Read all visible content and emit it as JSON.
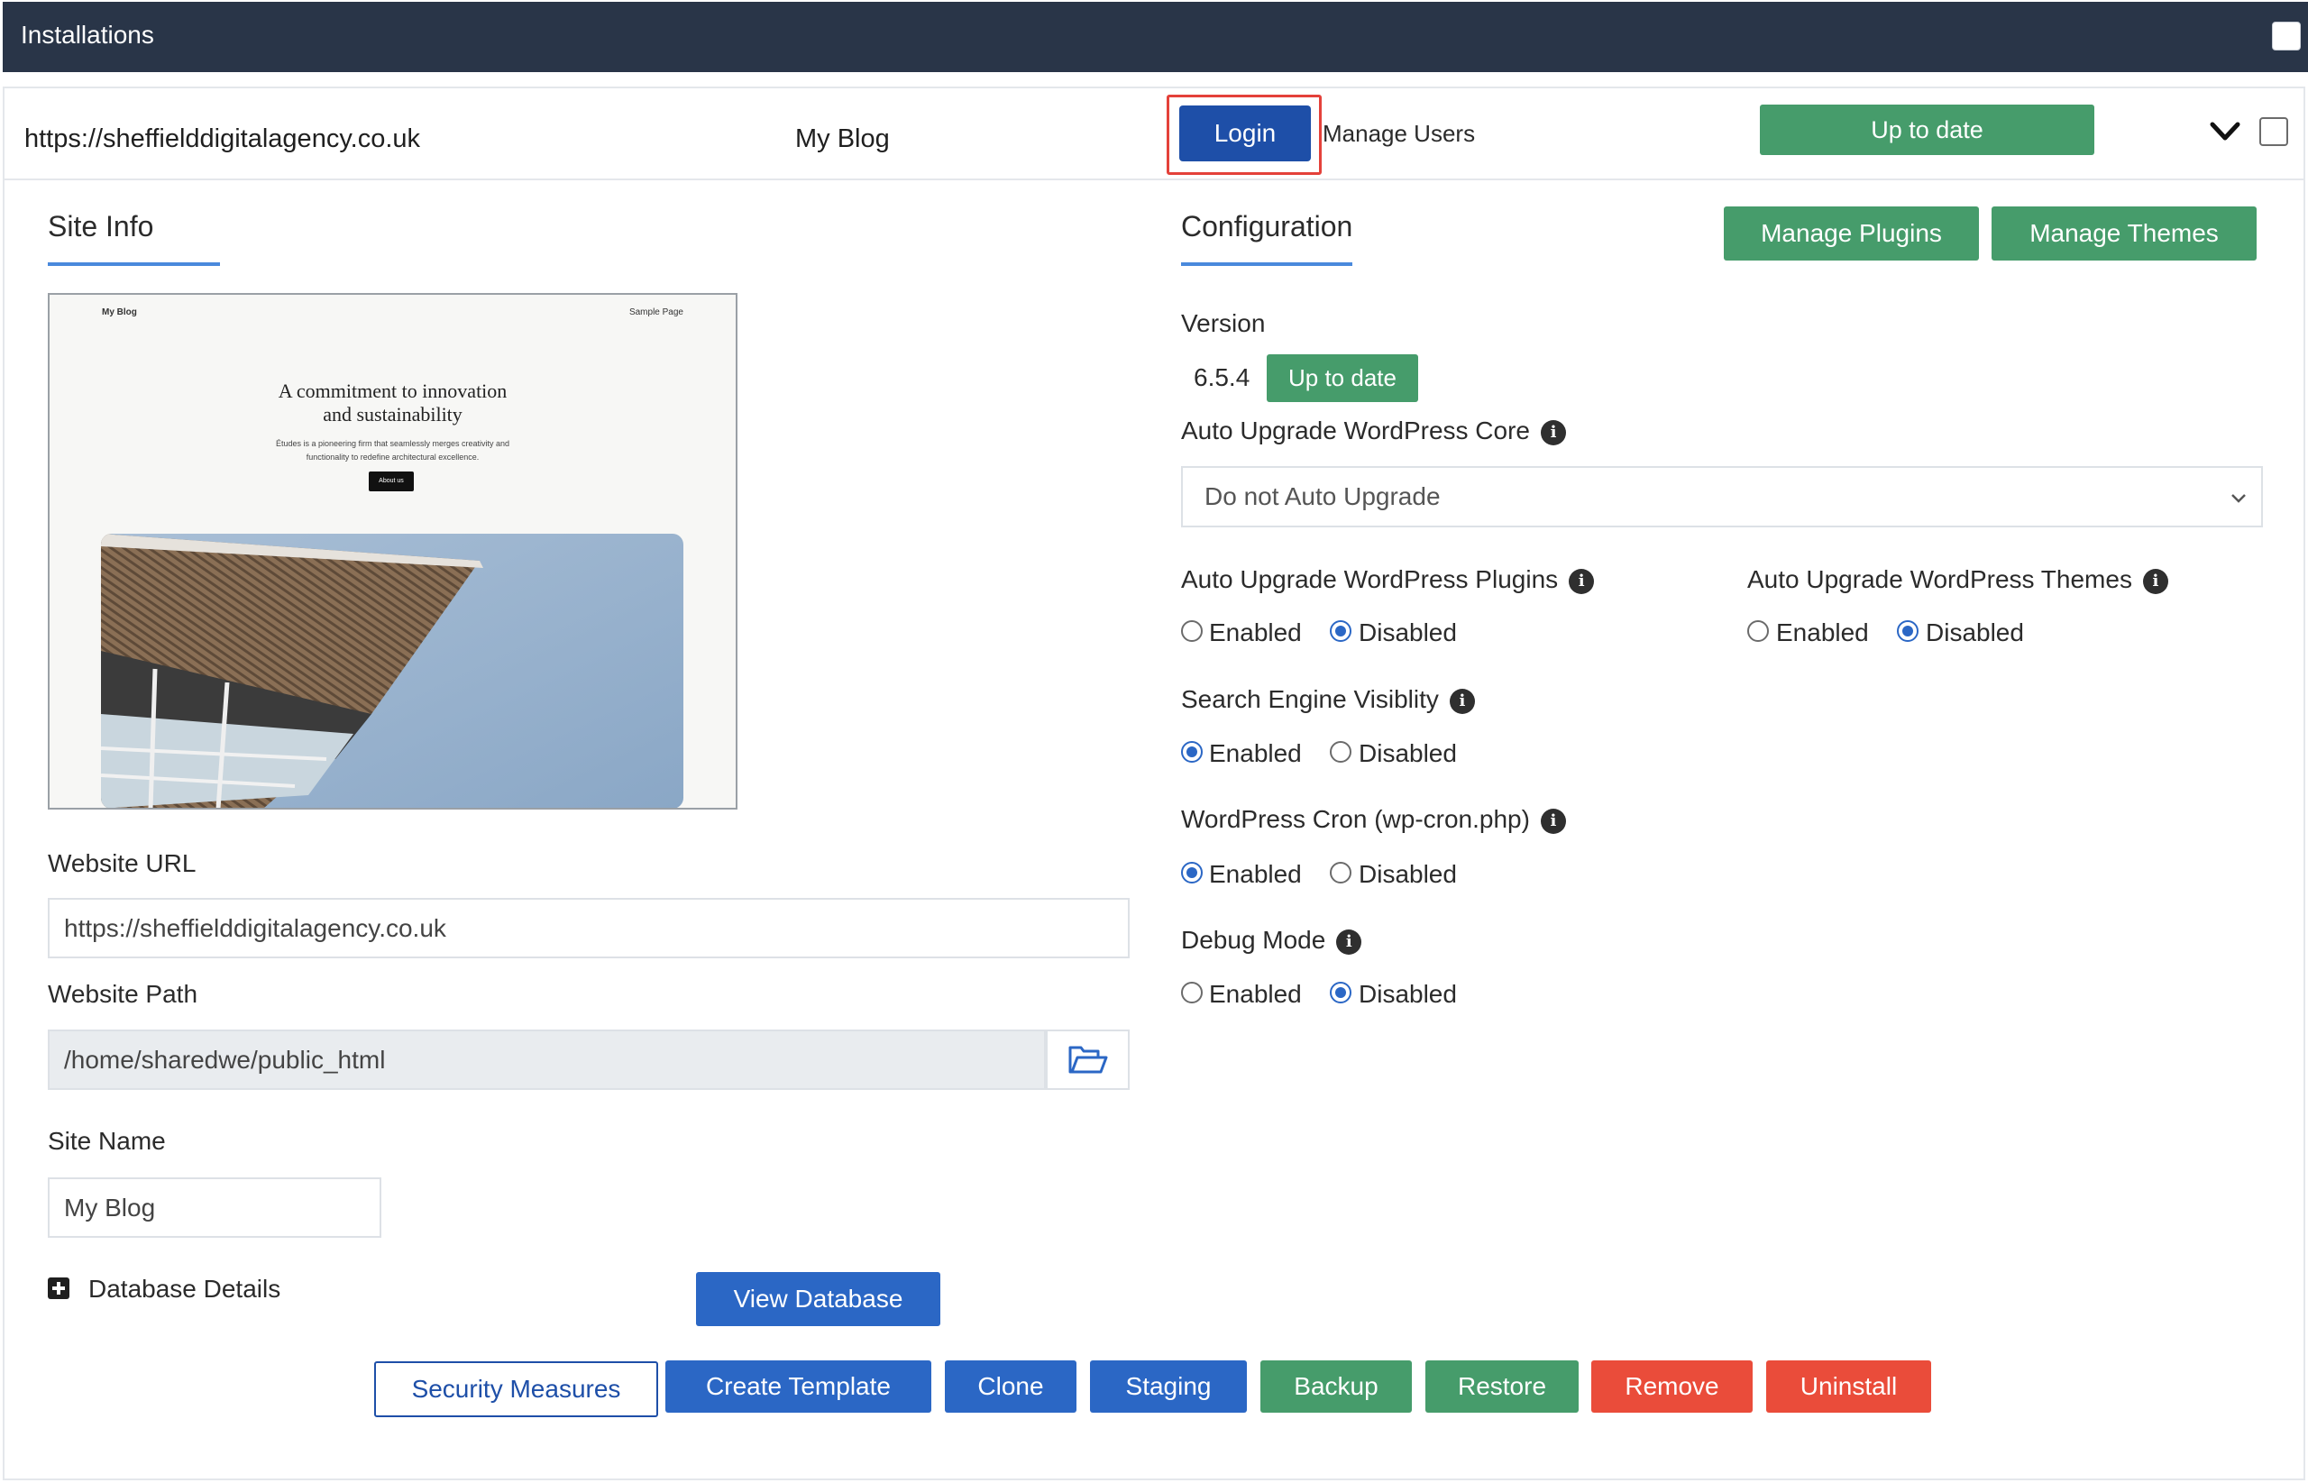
{
  "header": {
    "title": "Installations"
  },
  "install_row": {
    "url": "https://sheffielddigitalagency.co.uk",
    "site_name": "My Blog",
    "login_label": "Login",
    "manage_users_label": "Manage Users",
    "status_label": "Up to date"
  },
  "site_info": {
    "section_title": "Site Info",
    "preview": {
      "nav_left": "My Blog",
      "nav_right": "Sample Page",
      "headline_1": "A commitment to innovation",
      "headline_2": "and sustainability",
      "text_1": "Études is a pioneering firm that seamlessly merges creativity and",
      "text_2": "functionality to redefine architectural excellence.",
      "button": "About us"
    },
    "website_url_label": "Website URL",
    "website_url_value": "https://sheffielddigitalagency.co.uk",
    "website_path_label": "Website Path",
    "website_path_value": "/home/sharedwe/public_html",
    "site_name_label": "Site Name",
    "site_name_value": "My Blog",
    "database_details_label": "Database Details",
    "view_database_label": "View Database"
  },
  "configuration": {
    "section_title": "Configuration",
    "manage_plugins_label": "Manage Plugins",
    "manage_themes_label": "Manage Themes",
    "version_label": "Version",
    "version_value": "6.5.4",
    "version_status": "Up to date",
    "auto_upgrade_core_label": "Auto Upgrade WordPress Core",
    "auto_upgrade_core_value": "Do not Auto Upgrade",
    "auto_upgrade_plugins_label": "Auto Upgrade WordPress Plugins",
    "auto_upgrade_themes_label": "Auto Upgrade WordPress Themes",
    "search_visibility_label": "Search Engine Visiblity",
    "wp_cron_label": "WordPress Cron (wp-cron.php)",
    "debug_mode_label": "Debug Mode",
    "enabled_label": "Enabled",
    "disabled_label": "Disabled",
    "settings": {
      "auto_upgrade_plugins": "Disabled",
      "auto_upgrade_themes": "Disabled",
      "search_engine_visibility": "Enabled",
      "wp_cron": "Enabled",
      "debug_mode": "Disabled"
    }
  },
  "actions": {
    "security_measures": "Security Measures",
    "create_template": "Create Template",
    "clone": "Clone",
    "staging": "Staging",
    "backup": "Backup",
    "restore": "Restore",
    "remove": "Remove",
    "uninstall": "Uninstall"
  },
  "colors": {
    "header_bg": "#293548",
    "primary_blue": "#2b67c5",
    "login_blue": "#1e4fa8",
    "success_green": "#469c6b",
    "danger_red": "#ea4c3a",
    "highlight_red": "#e4413a"
  }
}
